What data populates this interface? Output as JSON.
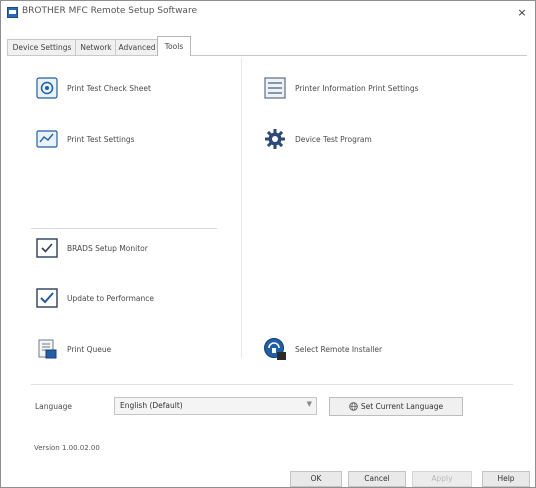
{
  "window": {
    "title": "BROTHER MFC Remote Setup Software",
    "app_icon": "app-icon",
    "close_label": "×"
  },
  "tabs": [
    {
      "label": "Device Settings",
      "active": false
    },
    {
      "label": "Network",
      "active": false
    },
    {
      "label": "Advanced",
      "active": false
    },
    {
      "label": "Tools",
      "active": true
    }
  ],
  "left_items": [
    {
      "label": "Print Test Check Sheet",
      "icon": "print-check-icon"
    },
    {
      "label": "Print Test Settings",
      "icon": "settings-print-icon"
    },
    {
      "label": "BRADS Setup Monitor",
      "icon": "monitor-check-icon"
    },
    {
      "label": "Update to Performance",
      "icon": "checkbox-icon"
    },
    {
      "label": "Print Queue",
      "icon": "print-queue-icon"
    }
  ],
  "right_items": [
    {
      "label": "Printer Information Print Settings",
      "icon": "printer-info-icon"
    },
    {
      "label": "Device Test Program",
      "icon": "gear-icon"
    },
    {
      "label": "Select Remote Installer",
      "icon": "remote-installer-icon"
    }
  ],
  "language": {
    "label": "Language",
    "value": "English (Default)"
  },
  "set_home_button": "Set Current Language",
  "version": "Version 1.00.02.00",
  "buttons": {
    "ok": "OK",
    "cancel": "Cancel",
    "apply": "Apply",
    "help": "Help"
  },
  "colors": {
    "accent": "#1f5fa8",
    "window_border": "#8f8f8f",
    "button_bg": "#e9e9e9"
  }
}
